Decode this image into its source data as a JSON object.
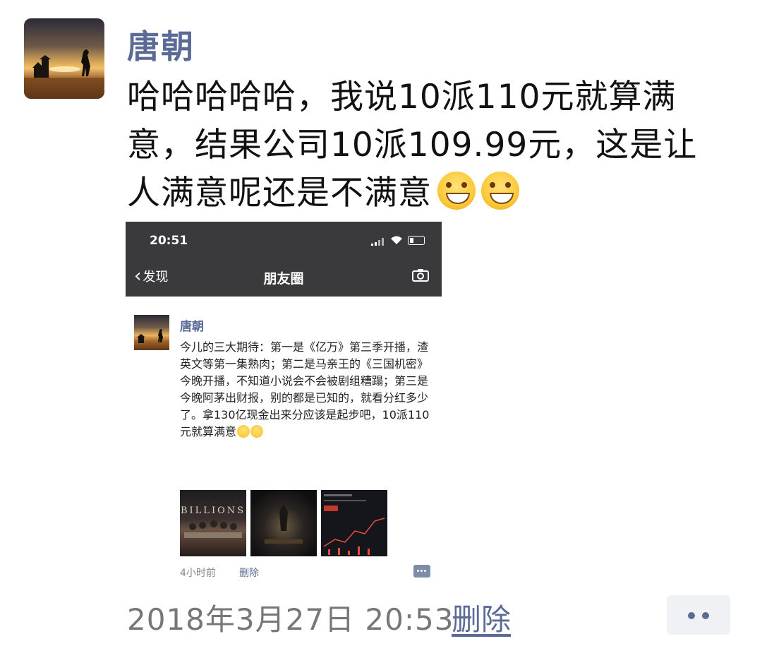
{
  "post": {
    "author": "唐朝",
    "text_line1": "哈哈哈哈哈，我说10派110元就算满",
    "text_line2": "意，结果公司10派109.99元，这是让",
    "text_line3": "人满意呢还是不满意",
    "timestamp": "2018年3月27日 20:53",
    "delete_label": "删除"
  },
  "screenshot": {
    "status_time": "20:51",
    "back_label": "发现",
    "nav_title": "朋友圈",
    "moment": {
      "author": "唐朝",
      "text": "今儿的三大期待：第一是《亿万》第三季开播，渣英文等第一集熟肉；第二是马亲王的《三国机密》今晚开播，不知道小说会不会被剧组糟蹋；第三是今晚阿茅出财报，别的都是已知的，就看分红多少了。拿130亿现金出来分应该是起步吧，10派110元就算满意",
      "images": [
        "BILLIONS"
      ],
      "time": "4小时前",
      "delete_label": "删除"
    }
  }
}
